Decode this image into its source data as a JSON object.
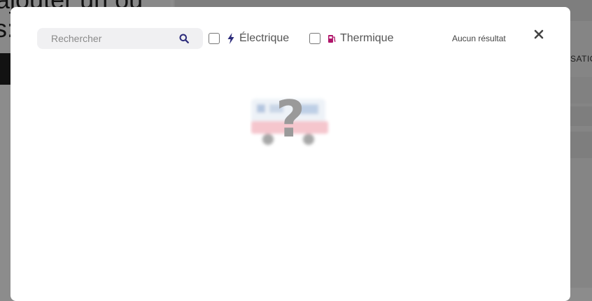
{
  "background": {
    "title_fragment_1": "ajouter un ou",
    "title_fragment_2": "s:",
    "side_text": "SATIO"
  },
  "modal": {
    "search": {
      "placeholder": "Rechercher",
      "value": "",
      "icon": "search-icon"
    },
    "filters": [
      {
        "label": "Électrique",
        "checked": false,
        "icon": "lightning-bolt-icon",
        "color": "#2b2a7a"
      },
      {
        "label": "Thermique",
        "checked": false,
        "icon": "fuel-pump-icon",
        "color": "#b0156a"
      }
    ],
    "result_count": "Aucun résultat",
    "close_icon": "close-icon",
    "empty_state_icon": "missing-vehicle-image-icon"
  },
  "colors": {
    "accent_navy": "#2b2a7a",
    "accent_magenta": "#b0156a"
  }
}
